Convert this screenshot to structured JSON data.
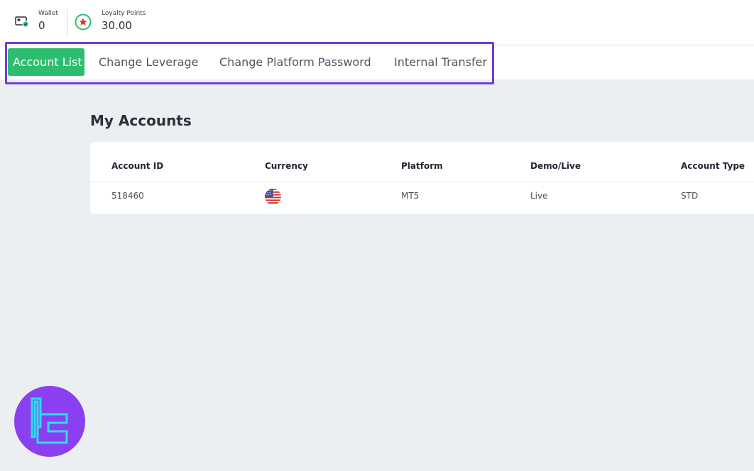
{
  "header": {
    "wallet": {
      "label": "Wallet",
      "value": "0",
      "icon": "wallet-icon"
    },
    "loyalty": {
      "label": "Loyalty Points",
      "value": "30.00",
      "icon": "star-badge-icon"
    }
  },
  "tabs": [
    {
      "label": "Account List",
      "active": true
    },
    {
      "label": "Change Leverage",
      "active": false
    },
    {
      "label": "Change Platform Password",
      "active": false
    },
    {
      "label": "Internal Transfer",
      "active": false
    }
  ],
  "main": {
    "title": "My Accounts",
    "table": {
      "headers": [
        "Account ID",
        "Currency",
        "Platform",
        "Demo/Live",
        "Account Type"
      ],
      "rows": [
        {
          "account_id": "518460",
          "currency_icon": "us-flag-icon",
          "platform": "MT5",
          "demo_live": "Live",
          "account_type": "STD"
        }
      ]
    }
  },
  "colors": {
    "accent_green": "#2dbd6e",
    "highlight_purple": "#6d3fd6",
    "page_bg": "#ebeff2",
    "logo_purple": "#8a3ff0",
    "logo_cyan": "#29e0f0"
  }
}
